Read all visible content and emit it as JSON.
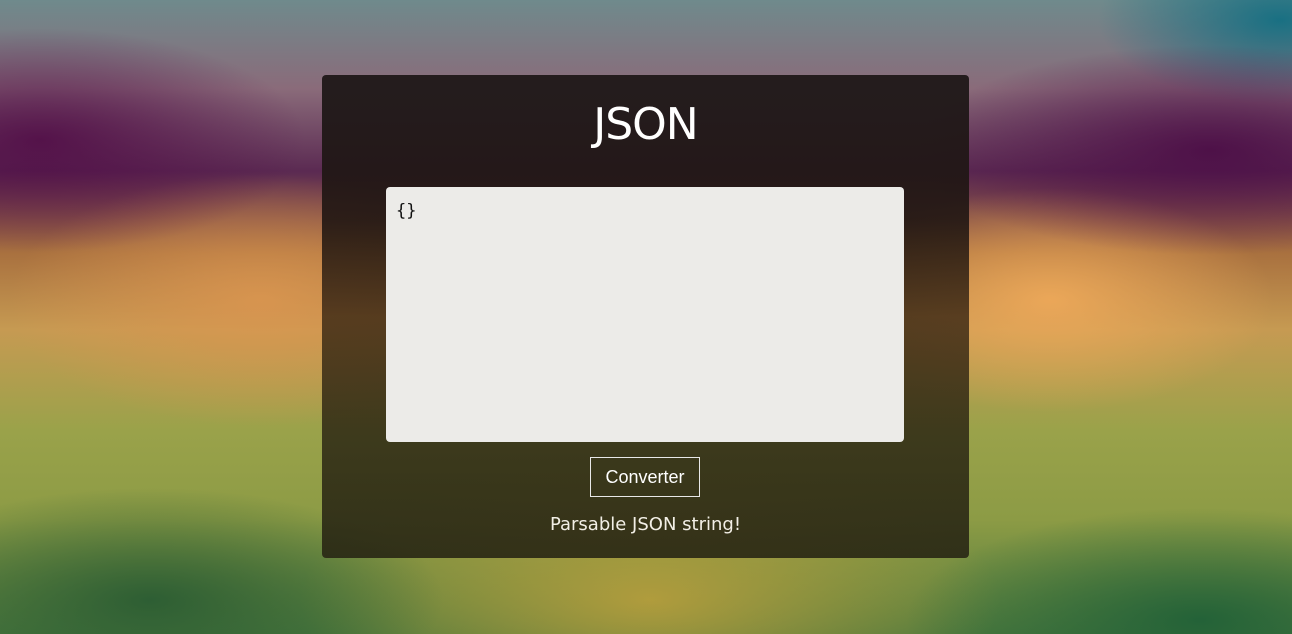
{
  "app": {
    "title": "JSON"
  },
  "editor": {
    "value": "{}"
  },
  "actions": {
    "convert_label": "Converter"
  },
  "status": {
    "message": "Parsable JSON string!"
  },
  "colors": {
    "panel": "#241c18",
    "editor_bg": "#ecebe8",
    "text": "#ffffff"
  }
}
